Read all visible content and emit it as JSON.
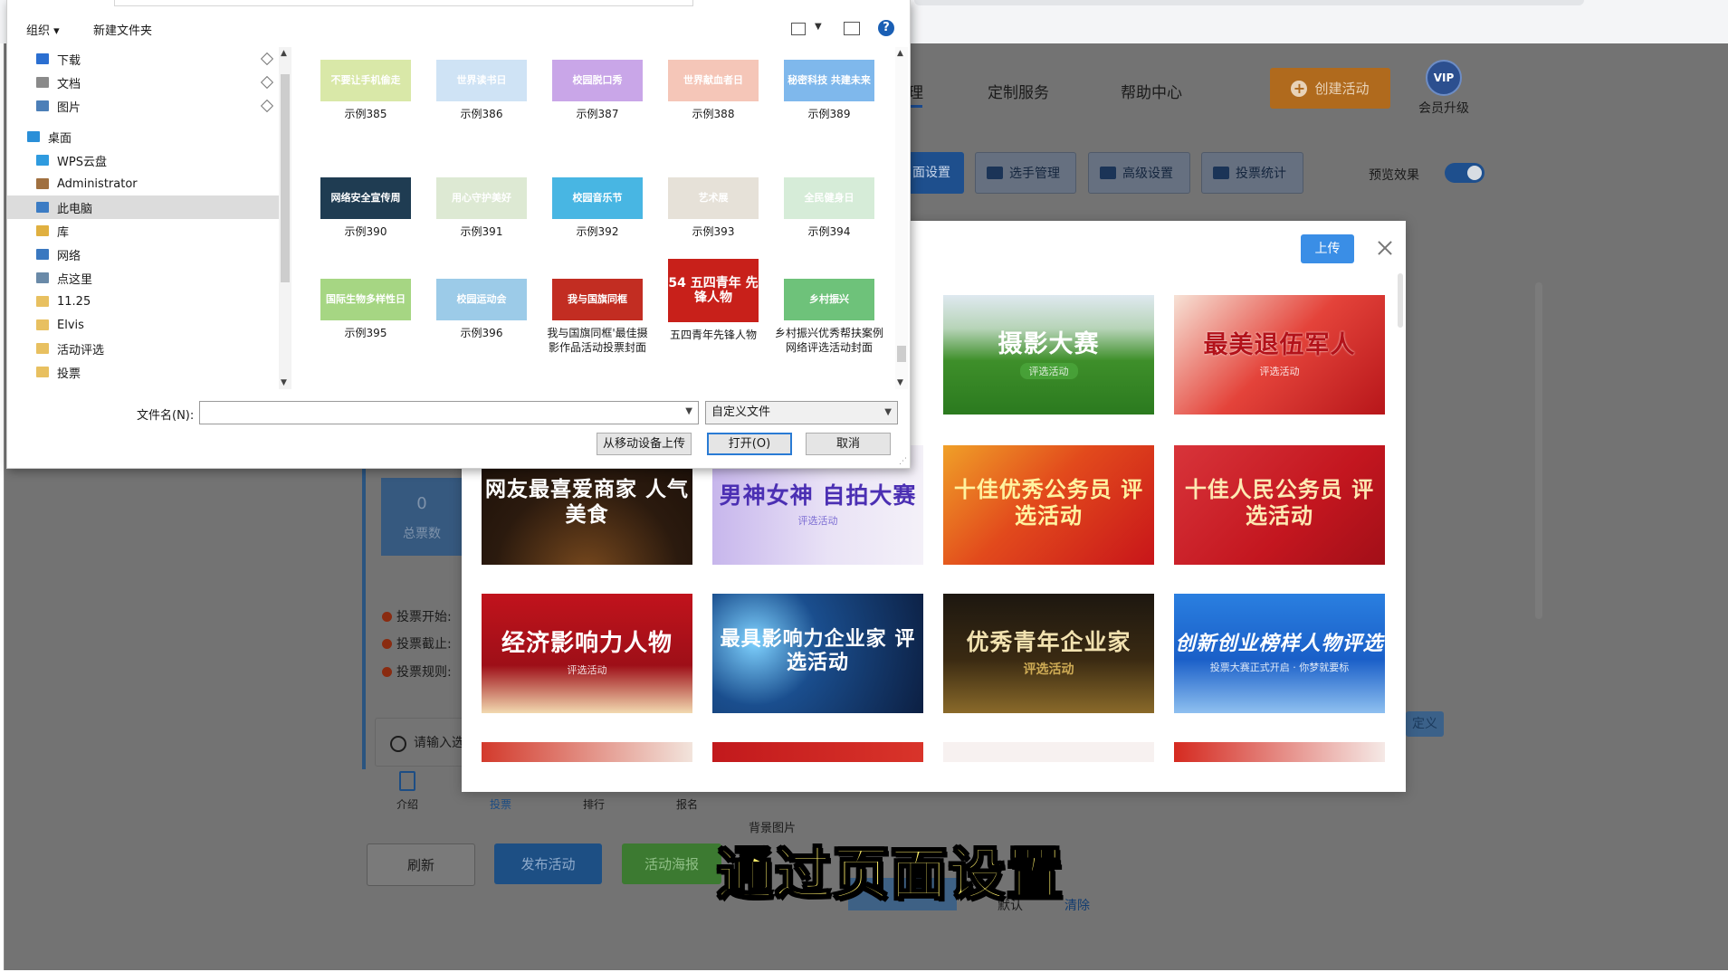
{
  "app": {
    "nav": {
      "active_fragment": "理",
      "custom_service": "定制服务",
      "help_center": "帮助中心"
    },
    "create_activity": "创建活动",
    "vip": {
      "badge": "VIP",
      "label": "会员升级"
    },
    "toolbar": {
      "page_settings": "面设置",
      "contestants": "选手管理",
      "advanced": "高级设置",
      "vote_stats": "投票统计",
      "preview_label": "预览效果"
    },
    "stat": {
      "value": "0",
      "label": "总票数"
    },
    "rows": [
      "投票开始:",
      "投票截止:",
      "投票规则:"
    ],
    "search_placeholder": "请输入选",
    "tabs": [
      "介绍",
      "投票",
      "排行",
      "报名"
    ],
    "buttons": {
      "refresh": "刷新",
      "publish": "发布活动",
      "poster": "活动海报"
    },
    "bg_image_label": "背景图片",
    "define_btn": "定义",
    "default_link": "默认",
    "clear_link": "清除"
  },
  "modal": {
    "upload": "上传",
    "tiles": [
      {
        "t1": "摄影大赛",
        "t2": "评选活动"
      },
      {
        "t1": "最美退伍军人",
        "t2": "评选活动"
      },
      {
        "t1": "网友最喜爱商家 人气美食",
        "t2": ""
      },
      {
        "t1": "男神女神 自拍大赛",
        "t2": "评选活动"
      },
      {
        "t1": "十佳优秀公务员 评选活动",
        "t2": ""
      },
      {
        "t1": "十佳人民公务员 评选活动",
        "t2": ""
      },
      {
        "t1": "经济影响力人物",
        "t2": "评选活动"
      },
      {
        "t1": "最具影响力企业家 评选活动",
        "t2": ""
      },
      {
        "t1": "优秀青年企业家",
        "t2": "评选活动"
      },
      {
        "t1": "创新创业榜样人物评选",
        "t2": "投票大赛正式开启 · 你梦就要标"
      }
    ]
  },
  "dialog": {
    "organize": "组织 ▾",
    "new_folder": "新建文件夹",
    "help": "?",
    "nav": [
      {
        "label": "下载",
        "pinned": true,
        "color": "#2b6fd1"
      },
      {
        "label": "文档",
        "pinned": true,
        "color": "#8a8a8a"
      },
      {
        "label": "图片",
        "pinned": true,
        "color": "#4c7fb8"
      },
      {
        "label": "桌面",
        "pinned": false,
        "color": "#2a8fd8"
      },
      {
        "label": "WPS云盘",
        "pinned": false,
        "color": "#2f9bdf"
      },
      {
        "label": "Administrator",
        "pinned": false,
        "color": "#a07040"
      },
      {
        "label": "此电脑",
        "pinned": false,
        "color": "#3c7cc4"
      },
      {
        "label": "库",
        "pinned": false,
        "color": "#e0b040"
      },
      {
        "label": "网络",
        "pinned": false,
        "color": "#3a78c0"
      },
      {
        "label": "点这里",
        "pinned": false,
        "color": "#6a8aa8"
      },
      {
        "label": "11.25",
        "pinned": false,
        "color": "#e8c060"
      },
      {
        "label": "Elvis",
        "pinned": false,
        "color": "#e8c060"
      },
      {
        "label": "活动评选",
        "pinned": false,
        "color": "#e8c060"
      },
      {
        "label": "投票",
        "pinned": false,
        "color": "#e8c060"
      }
    ],
    "files": [
      {
        "name": "示例385",
        "thumb": "不要让手机偷走",
        "color": "#d9e8a8"
      },
      {
        "name": "示例386",
        "thumb": "世界读书日",
        "color": "#cfe3f5"
      },
      {
        "name": "示例387",
        "thumb": "校园脱口秀",
        "color": "#c9a6e8"
      },
      {
        "name": "示例388",
        "thumb": "世界献血者日",
        "color": "#f5c6b8"
      },
      {
        "name": "示例389",
        "thumb": "秘密科技 共建未来",
        "color": "#7fb8ec"
      },
      {
        "name": "示例390",
        "thumb": "网络安全宣传周",
        "color": "#1f3c52"
      },
      {
        "name": "示例391",
        "thumb": "用心守护美好",
        "color": "#dde9d3"
      },
      {
        "name": "示例392",
        "thumb": "校园音乐节",
        "color": "#48b6e3"
      },
      {
        "name": "示例393",
        "thumb": "艺术展",
        "color": "#e6e1d8"
      },
      {
        "name": "示例394",
        "thumb": "全民健身日",
        "color": "#d6ecd8"
      },
      {
        "name": "示例395",
        "thumb": "国际生物多样性日",
        "color": "#a6d683"
      },
      {
        "name": "示例396",
        "thumb": "校园运动会",
        "color": "#9ccbe8"
      },
      {
        "name": "我与国旗同框'最佳摄影作品活动投票封面",
        "thumb": "我与国旗同框",
        "color": "#c22d22"
      },
      {
        "name": "五四青年先锋人物",
        "thumb": "54 五四青年 先锋人物",
        "color": "#c8201a"
      },
      {
        "name": "乡村振兴优秀帮扶案例网络评选活动封面",
        "thumb": "乡村振兴",
        "color": "#6ec27a"
      }
    ],
    "filename_label": "文件名(N):",
    "filename_value": "",
    "filetype": "自定义文件",
    "upload_from_device": "从移动设备上传",
    "open": "打开(O)",
    "cancel": "取消"
  },
  "subtitle": "通过页面设置"
}
